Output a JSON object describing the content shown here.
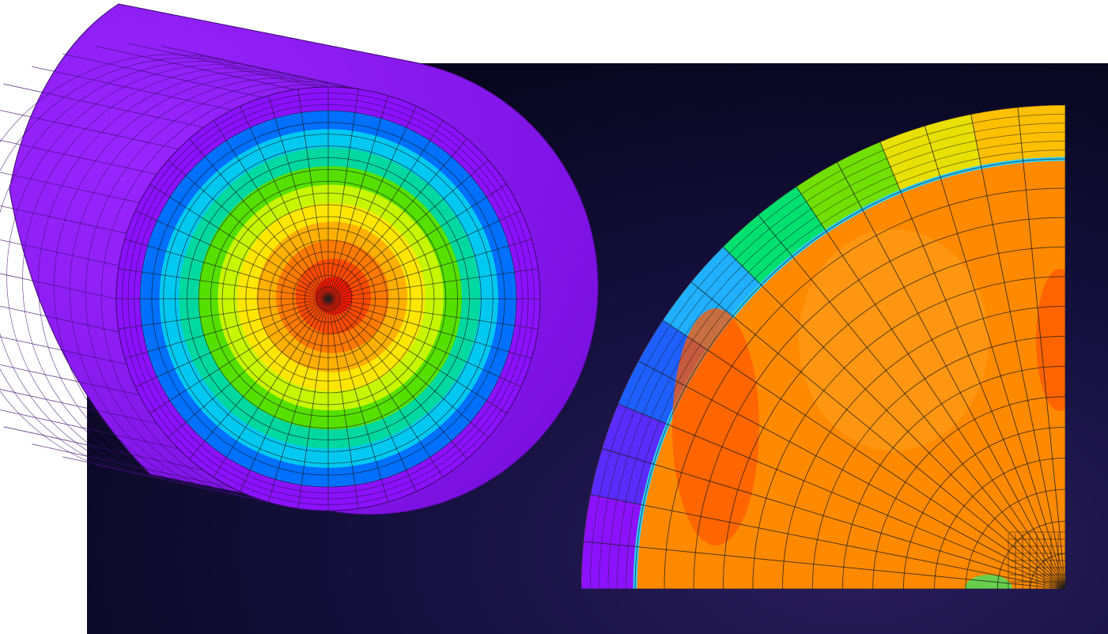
{
  "figure": {
    "panels": [
      {
        "name": "cylinder-cross-section",
        "contour_bands_center_to_edge": [
          "#ff1a00",
          "#ff4a00",
          "#ff7a00",
          "#ffb000",
          "#ffe600",
          "#c8f500",
          "#55e000",
          "#00d8a0",
          "#00c8f0",
          "#0070ff"
        ],
        "shell_color": "#8c12ff",
        "mesh_line_color": "#1a1a1a"
      },
      {
        "name": "quarter-section-closeup",
        "fill_color": "#ff8a00",
        "shell_color": "#8c12ff",
        "mesh_line_color": "#1a1a1a"
      }
    ],
    "background_color": "#0c0a2e"
  }
}
